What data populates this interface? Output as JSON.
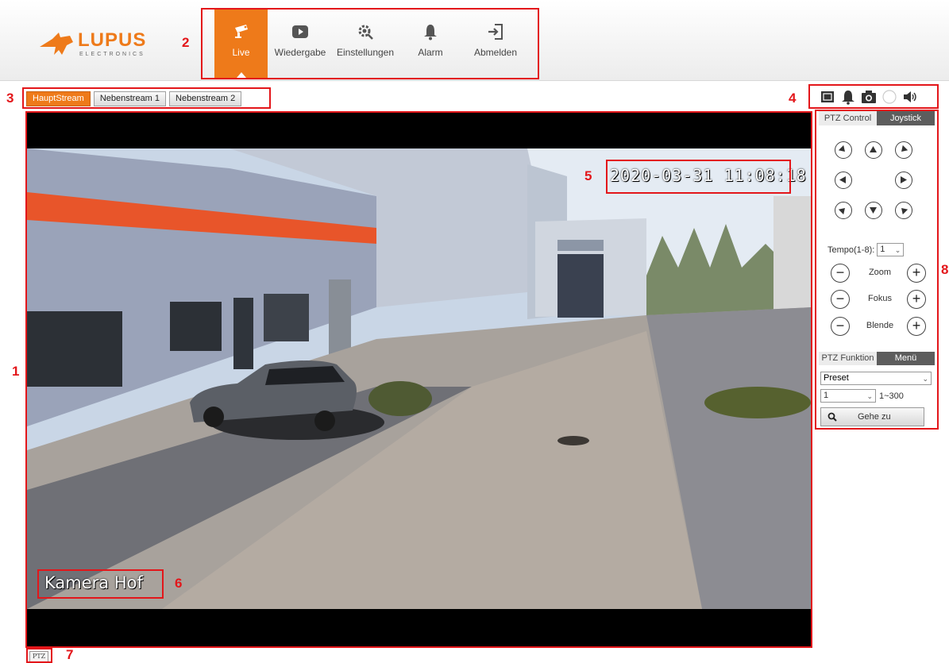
{
  "brand": {
    "name": "LUPUS",
    "sub": "ELECTRONICS",
    "accent": "#ee7a1a",
    "annotation_color": "#e3161a"
  },
  "nav": {
    "items": [
      {
        "label": "Live",
        "icon": "camera-icon",
        "active": true
      },
      {
        "label": "Wiedergabe",
        "icon": "play-icon"
      },
      {
        "label": "Einstellungen",
        "icon": "settings-icon"
      },
      {
        "label": "Alarm",
        "icon": "bell-icon"
      },
      {
        "label": "Abmelden",
        "icon": "logout-icon"
      }
    ]
  },
  "streams": {
    "tabs": [
      "HauptStream",
      "Nebenstream 1",
      "Nebenstream 2"
    ],
    "active": "HauptStream"
  },
  "tools": [
    "fullscreen-icon",
    "bell-icon",
    "snapshot-icon",
    "record-icon",
    "speaker-icon"
  ],
  "video": {
    "timestamp": "2020-03-31 11:08:18",
    "camera_name": "Kamera Hof"
  },
  "ptz": {
    "tabs": [
      "PTZ Control",
      "Joystick"
    ],
    "speed_label": "Tempo(1-8):",
    "speed_value": "1",
    "zoom_label": "Zoom",
    "focus_label": "Fokus",
    "iris_label": "Blende",
    "function_tabs": [
      "PTZ Funktion",
      "Menü"
    ],
    "function_select": "Preset",
    "preset_number": "1",
    "preset_range": "1~300",
    "goto_label": "Gehe zu"
  },
  "ptz_toggle": "PTZ",
  "annotations": [
    "1",
    "2",
    "3",
    "4",
    "5",
    "6",
    "7",
    "8"
  ]
}
